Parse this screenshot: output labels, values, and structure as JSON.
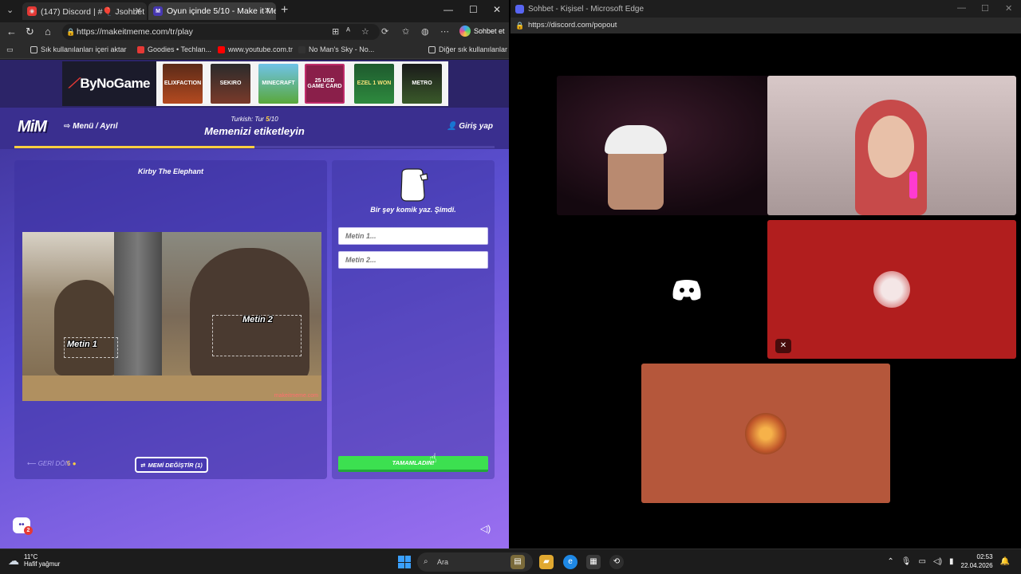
{
  "browser": {
    "tabs": [
      {
        "title": "(147) Discord | #🎈 Jsohbet",
        "active": false
      },
      {
        "title": "Oyun içinde 5/10 - Make it Meme",
        "active": true
      }
    ],
    "url": "https://makeitmeme.com/tr/play",
    "copilot_label": "Sohbet et",
    "bookmarks": [
      "Sık kullanılanları içeri aktar",
      "Goodies • Techlan...",
      "www.youtube.com.tr",
      "No Man's Sky - No...",
      "Diğer sık kullanılanlar"
    ]
  },
  "ad": {
    "brand": "ByNoGame",
    "cards": [
      "ELIXFACTION",
      "SEKIRO",
      "MINECRAFT",
      "25 USD GAME CARD",
      "EZEL 1 WON",
      "METRO"
    ]
  },
  "game": {
    "logo": "MiM",
    "menu": "Menü / Ayrıl",
    "round_prefix": "Turkish: Tur",
    "round_current": "5",
    "round_total": "/10",
    "round_title": "Memenizi etiketleyin",
    "login": "Giriş yap",
    "progress": 0.5,
    "meme_title": "Kirby The Elephant",
    "meme_text_1": "Metin 1",
    "meme_text_2": "Metin 2",
    "watermark": "makeitmeme.com",
    "back": "GERİ DÖN",
    "coins": "5",
    "change_meme": "MEMİ DEĞİŞTİR (1)",
    "prompt": "Bir şey komik yaz. Şimdi.",
    "input1_placeholder": "Metin 1...",
    "input2_placeholder": "Metin 2...",
    "done": "TAMAMLADIN!",
    "chat_badge": "2"
  },
  "discord": {
    "window_title": "Sohbet - Kişisel - Microsoft Edge",
    "url": "https://discord.com/popout"
  },
  "taskbar": {
    "temperature": "11°C",
    "weather": "Hafif yağmur",
    "search": "Ara",
    "time": "02:53",
    "date": "22.04.2026"
  },
  "colors": {
    "page_bg": "#5b4fd0",
    "accent_yellow": "#ffcf40",
    "done_green": "#3ce050",
    "discord_blurple": "#5865f2",
    "tile_red": "#b11e1e",
    "tile_orange": "#b5573b"
  }
}
